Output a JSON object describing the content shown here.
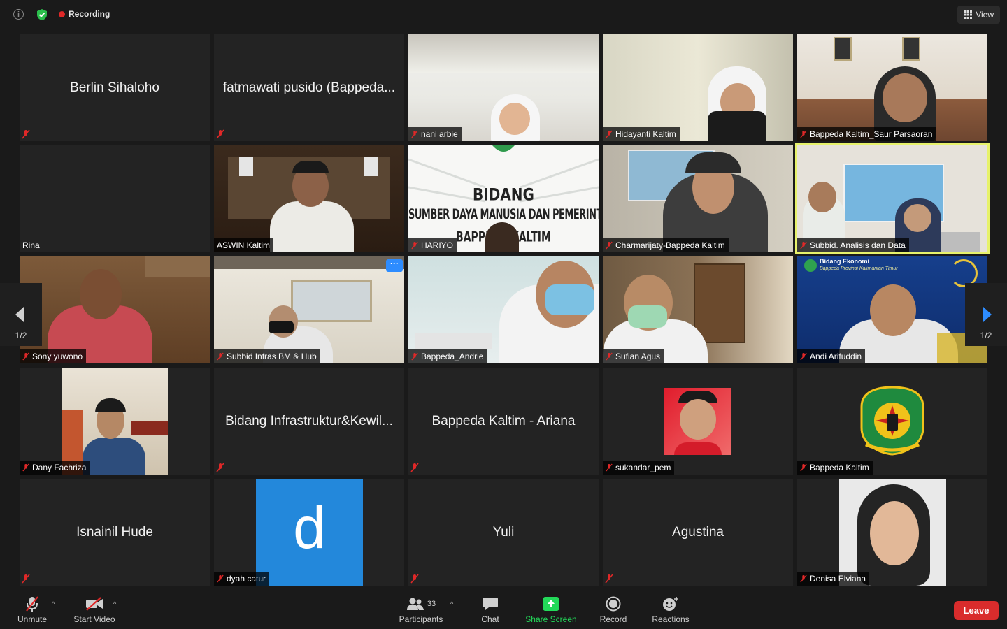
{
  "topbar": {
    "info_icon": "info-icon",
    "security_icon": "shield-check-icon",
    "recording_label": "Recording",
    "view_label": "View"
  },
  "participants": [
    {
      "name": "Berlin Sihaloho",
      "display": "name"
    },
    {
      "name": "fatmawati pusido (Bappeda...",
      "display": "name"
    },
    {
      "name": "nani arbie",
      "display": "video"
    },
    {
      "name": "Hidayanti Kaltim",
      "display": "video"
    },
    {
      "name": "Bappeda Kaltim_Saur Parsaoran",
      "display": "video"
    },
    {
      "name": "Rina",
      "display": "video-off"
    },
    {
      "name": "ASWIN Kaltim",
      "display": "video"
    },
    {
      "name": "HARIYO",
      "display": "video"
    },
    {
      "name": "Charmarijaty-Bappeda Kaltim",
      "display": "video"
    },
    {
      "name": "Subbid. Analisis dan Data",
      "display": "video",
      "speaking": true
    },
    {
      "name": "Sony yuwono",
      "display": "video"
    },
    {
      "name": "Subbid Infras BM & Hub",
      "display": "video"
    },
    {
      "name": "Bappeda_Andrie",
      "display": "video"
    },
    {
      "name": "Sufian Agus",
      "display": "video"
    },
    {
      "name": "Andi Arifuddin",
      "display": "video"
    },
    {
      "name": "Dany Fachriza",
      "display": "photo"
    },
    {
      "name": "Bidang Infrastruktur&Kewil...",
      "display": "name"
    },
    {
      "name": "Bappeda Kaltim - Ariana",
      "display": "name"
    },
    {
      "name": "sukandar_pem",
      "display": "photo"
    },
    {
      "name": "Bappeda Kaltim",
      "display": "photo"
    },
    {
      "name": "Isnainil Hude",
      "display": "name"
    },
    {
      "name": "dyah catur",
      "display": "letter",
      "letter": "d"
    },
    {
      "name": "Yuli",
      "display": "name"
    },
    {
      "name": "Agustina",
      "display": "name"
    },
    {
      "name": "Denisa Elviana",
      "display": "photo"
    }
  ],
  "slides": {
    "hariyo_line1": "BIDANG",
    "hariyo_line2": "SUMBER DAYA MANUSIA DAN PEMERINTAHAN",
    "hariyo_line3": "BAPPEDA KALTIM",
    "andi_banner1": "Bidang Ekonomi",
    "andi_banner2": "Bappeda Provinsi Kalimantan Timur",
    "more_options": "···"
  },
  "paging": {
    "left": "1/2",
    "right": "1/2"
  },
  "toolbar": {
    "unmute": "Unmute",
    "start_video": "Start Video",
    "participants_count": "33",
    "participants": "Participants",
    "chat": "Chat",
    "share_screen": "Share Screen",
    "record": "Record",
    "reactions": "Reactions",
    "leave": "Leave"
  },
  "colors": {
    "tile_bg": "#232323",
    "speaker_outline": "#e7f26b",
    "share_green": "#23d959",
    "leave_red": "#d92c2c",
    "letter_avatar": "#2d8cff"
  }
}
